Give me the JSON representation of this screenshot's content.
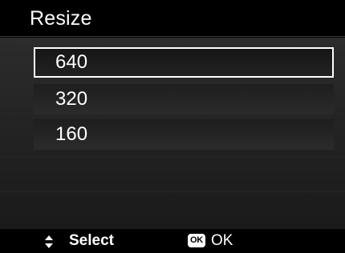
{
  "header": {
    "title": "Resize"
  },
  "menu": {
    "items": [
      {
        "label": "640",
        "selected": true
      },
      {
        "label": "320",
        "selected": false
      },
      {
        "label": "160",
        "selected": false
      }
    ]
  },
  "footer": {
    "select_label": "Select",
    "ok_badge": "OK",
    "ok_label": "OK",
    "navigate_icon": "up-down-arrows-icon"
  },
  "colors": {
    "selection_border": "#ffffff",
    "background": "#000000",
    "panel": "#262626",
    "text": "#ffffff"
  }
}
